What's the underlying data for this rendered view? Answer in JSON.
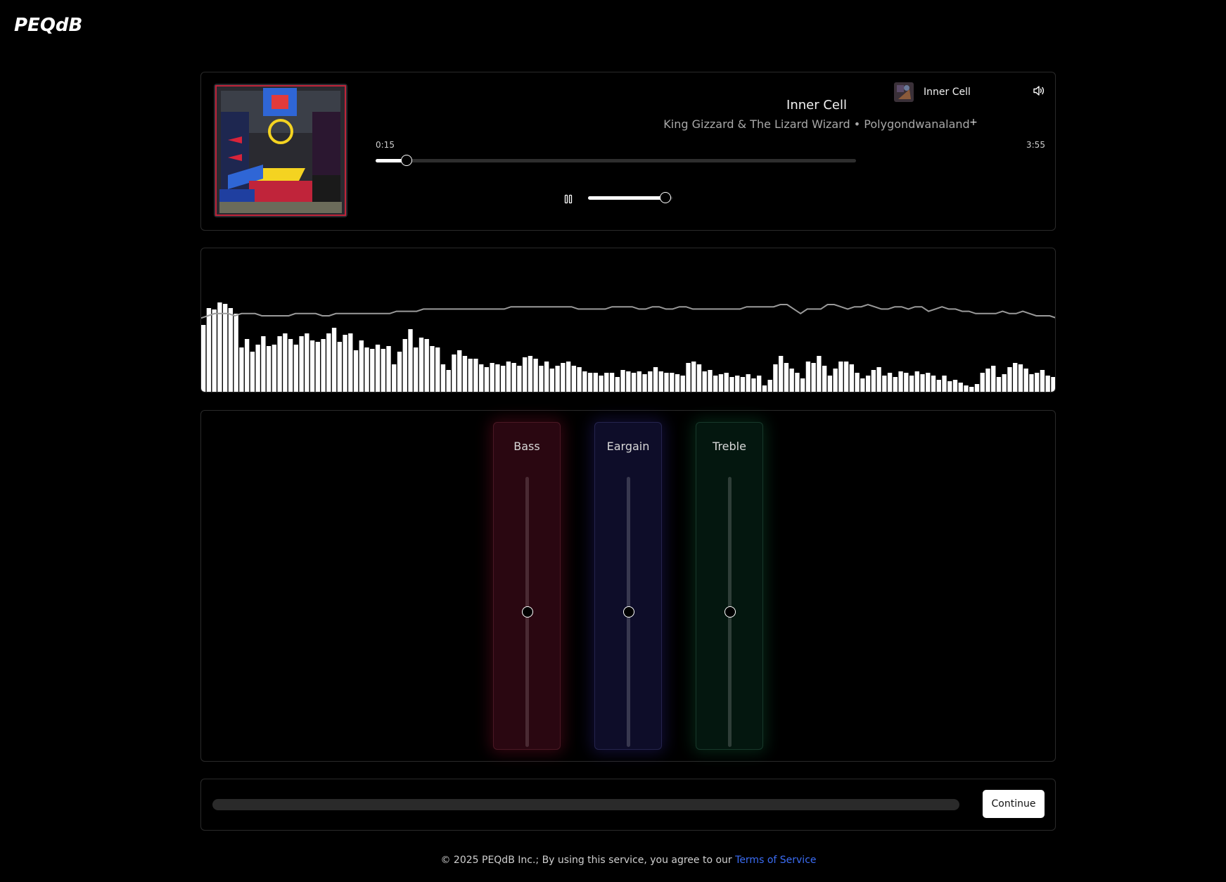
{
  "brand": {
    "logo_text": "PEQdB"
  },
  "player": {
    "title": "Inner Cell",
    "artist": "King Gizzard & The Lizard Wizard",
    "separator": " • ",
    "album": "Polygondwanaland",
    "current_time": "0:15",
    "duration": "3:55",
    "progress": 0.0638,
    "volume": 0.92,
    "pause_icon": "pause-icon"
  },
  "queue": {
    "item_label": "Inner Cell",
    "add_label": "+",
    "speaker_icon": "speaker-icon"
  },
  "visualizer": {
    "bars": [
      48,
      60,
      59,
      64,
      63,
      60,
      56,
      32,
      38,
      29,
      34,
      40,
      33,
      34,
      40,
      42,
      38,
      34,
      40,
      42,
      37,
      36,
      38,
      42,
      46,
      36,
      41,
      42,
      30,
      37,
      32,
      31,
      34,
      31,
      33,
      20,
      29,
      38,
      45,
      32,
      39,
      38,
      33,
      32,
      20,
      16,
      27,
      30,
      26,
      24,
      24,
      20,
      18,
      21,
      20,
      19,
      22,
      21,
      19,
      25,
      26,
      24,
      19,
      22,
      17,
      19,
      21,
      22,
      19,
      18,
      15,
      14,
      14,
      12,
      14,
      14,
      11,
      16,
      15,
      14,
      15,
      13,
      15,
      18,
      15,
      14,
      14,
      13,
      12,
      21,
      22,
      20,
      15,
      16,
      12,
      13,
      14,
      11,
      12,
      11,
      13,
      10,
      12,
      5,
      9,
      20,
      26,
      21,
      17,
      14,
      10,
      22,
      21,
      26,
      19,
      12,
      17,
      22,
      22,
      20,
      14,
      10,
      12,
      16,
      18,
      12,
      14,
      11,
      15,
      14,
      12,
      15,
      13,
      14,
      12,
      9,
      12,
      8,
      9,
      7,
      5,
      4,
      6,
      14,
      17,
      19,
      11,
      13,
      18,
      21,
      20,
      17,
      13,
      14,
      16,
      12,
      11
    ],
    "bar_scale_max": 64,
    "line": [
      4,
      5,
      6,
      6,
      6,
      5,
      6,
      6,
      6,
      5,
      5,
      5,
      5,
      5,
      6,
      6,
      6,
      6,
      5,
      5,
      6,
      6,
      6,
      6,
      6,
      6,
      6,
      6,
      6,
      7,
      7,
      7,
      7,
      8,
      8,
      8,
      8,
      8,
      8,
      8,
      8,
      8,
      8,
      8,
      8,
      8,
      9,
      9,
      9,
      9,
      9,
      9,
      9,
      9,
      9,
      9,
      8,
      8,
      8,
      8,
      8,
      9,
      9,
      9,
      9,
      8,
      8,
      9,
      9,
      8,
      8,
      9,
      9,
      8,
      8,
      8,
      8,
      8,
      8,
      8,
      8,
      9,
      9,
      9,
      9,
      9,
      10,
      10,
      8,
      6,
      8,
      8,
      8,
      10,
      10,
      9,
      8,
      9,
      9,
      10,
      9,
      8,
      8,
      9,
      9,
      8,
      9,
      9,
      7,
      8,
      9,
      8,
      8,
      7,
      7,
      6,
      6,
      6,
      6,
      7,
      6,
      6,
      7,
      6,
      5,
      5,
      5,
      4
    ]
  },
  "equalizer": {
    "bands": [
      {
        "label": "Bass",
        "value": 0.5
      },
      {
        "label": "Eargain",
        "value": 0.5
      },
      {
        "label": "Treble",
        "value": 0.5
      }
    ]
  },
  "bottom_bar": {
    "continue_label": "Continue"
  },
  "footer": {
    "copyright": "© 2025 PEQdB Inc.;  By using this service, you agree to our ",
    "tos_label": "Terms of Service"
  },
  "colors": {
    "bass": "#2a0711",
    "eargain": "#0e0d29",
    "treble": "#04170f",
    "link": "#3b6df5"
  }
}
